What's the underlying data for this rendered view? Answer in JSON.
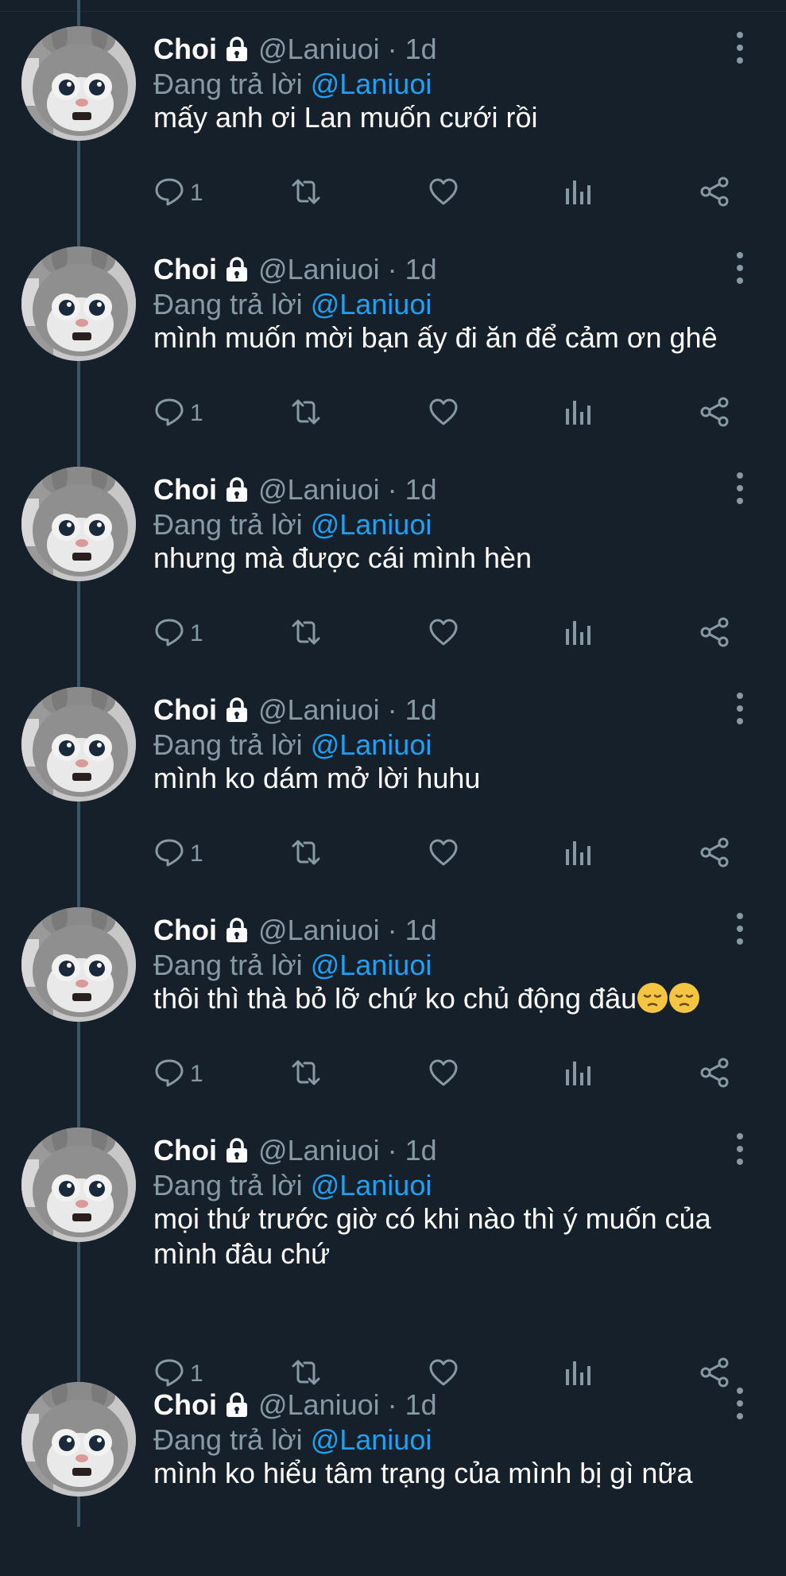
{
  "tweets": [
    {
      "name": "Choi",
      "meta": "@Laniuoi · 1d",
      "reply_prefix": "Đang trả lời ",
      "reply_to": "@Laniuoi",
      "text": "mấy anh ơi Lan muốn cưới rồi",
      "reply_count": "1",
      "emoji": false,
      "two_lines": false
    },
    {
      "name": "Choi",
      "meta": "@Laniuoi · 1d",
      "reply_prefix": "Đang trả lời ",
      "reply_to": "@Laniuoi",
      "text": "mình muốn mời bạn ấy đi ăn để cảm ơn ghê",
      "reply_count": "1",
      "emoji": false,
      "two_lines": false
    },
    {
      "name": "Choi",
      "meta": "@Laniuoi · 1d",
      "reply_prefix": "Đang trả lời ",
      "reply_to": "@Laniuoi",
      "text": "nhưng mà được cái mình hèn",
      "reply_count": "1",
      "emoji": false,
      "two_lines": false
    },
    {
      "name": "Choi",
      "meta": "@Laniuoi · 1d",
      "reply_prefix": "Đang trả lời ",
      "reply_to": "@Laniuoi",
      "text": "mình ko dám mở lời huhu",
      "reply_count": "1",
      "emoji": false,
      "two_lines": false
    },
    {
      "name": "Choi",
      "meta": "@Laniuoi · 1d",
      "reply_prefix": "Đang trả lời ",
      "reply_to": "@Laniuoi",
      "text": "thôi thì thà bỏ lỡ chứ ko chủ động đâu",
      "reply_count": "1",
      "emoji": true,
      "emoji_name": "pensive-face-icon",
      "two_lines": false
    },
    {
      "name": "Choi",
      "meta": "@Laniuoi · 1d",
      "reply_prefix": "Đang trả lời ",
      "reply_to": "@Laniuoi",
      "text": "mọi thứ trước giờ có khi nào thì ý muốn của mình đâu chứ",
      "reply_count": "1",
      "emoji": false,
      "two_lines": true
    },
    {
      "name": "Choi",
      "meta": "@Laniuoi · 1d",
      "reply_prefix": "Đang trả lời ",
      "reply_to": "@Laniuoi",
      "text": "mình ko hiểu tâm trạng của mình bị gì nữa",
      "reply_count": "",
      "emoji": false,
      "two_lines": false
    }
  ],
  "icons": {
    "reply": "reply-icon",
    "retweet": "retweet-icon",
    "like": "heart-icon",
    "stats": "analytics-icon",
    "share": "share-icon",
    "more": "more-options-icon",
    "lock": "lock-icon"
  },
  "colors": {
    "background": "#15202b",
    "secondary_text": "#8899a6",
    "mention": "#1da1f2",
    "thread_line": "#3d5466"
  }
}
